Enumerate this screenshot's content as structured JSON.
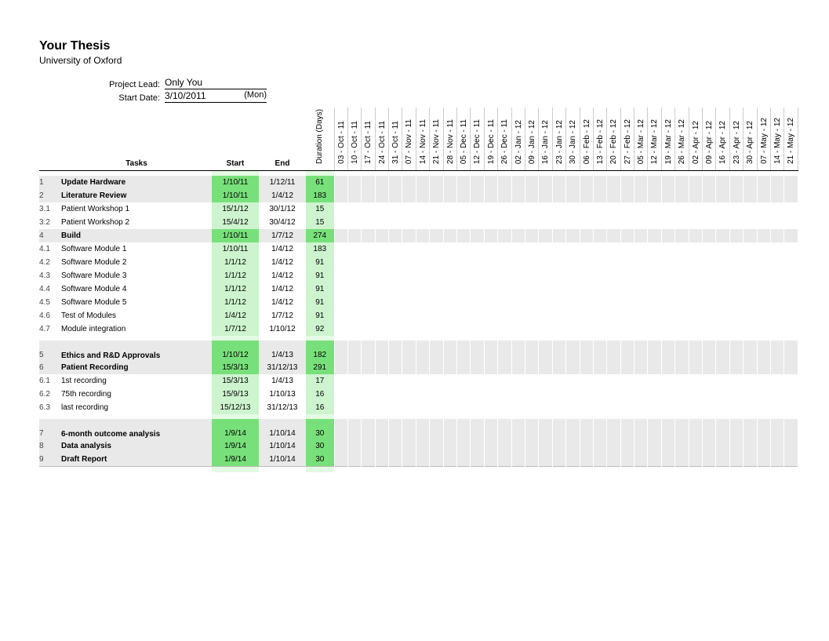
{
  "header": {
    "title": "Your Thesis",
    "subtitle": "University of Oxford",
    "lead_label": "Project Lead:",
    "lead_value": "Only You",
    "start_label": "Start Date:",
    "start_value": "3/10/2011",
    "start_day": "(Mon)"
  },
  "columns": {
    "tasks": "Tasks",
    "start": "Start",
    "end": "End",
    "duration": "Duration (Days)"
  },
  "dates": [
    "03 - Oct - 11",
    "10 - Oct - 11",
    "17 - Oct - 11",
    "24 - Oct - 11",
    "31 - Oct - 11",
    "07 - Nov - 11",
    "14 - Nov - 11",
    "21 - Nov - 11",
    "28 - Nov - 11",
    "05 - Dec - 11",
    "12 - Dec - 11",
    "19 - Dec - 11",
    "26 - Dec - 11",
    "02 - Jan - 12",
    "09 - Jan - 12",
    "16 - Jan - 12",
    "23 - Jan - 12",
    "30 - Jan - 12",
    "06 - Feb - 12",
    "13 - Feb - 12",
    "20 - Feb - 12",
    "27 - Feb - 12",
    "05 - Mar - 12",
    "12 - Mar - 12",
    "19 - Mar - 12",
    "26 - Mar - 12",
    "02 - Apr - 12",
    "09 - Apr - 12",
    "16 - Apr - 12",
    "23 - Apr - 12",
    "30 - Apr - 12",
    "07 - May - 12",
    "14 - May - 12",
    "21 - May - 12"
  ],
  "rows": [
    {
      "type": "spacer"
    },
    {
      "num": "1",
      "task": "Update Hardware",
      "start": "1/10/11",
      "end": "1/12/11",
      "dur": "61",
      "bold": true,
      "shade": true
    },
    {
      "num": "2",
      "task": "Literature Review",
      "start": "1/10/11",
      "end": "1/4/12",
      "dur": "183",
      "bold": true,
      "shade": true
    },
    {
      "num": "3.1",
      "task": "Patient Workshop 1",
      "start": "15/1/12",
      "end": "30/1/12",
      "dur": "15",
      "bold": false,
      "shade": false
    },
    {
      "num": "3.2",
      "task": "Patient Workshop 2",
      "start": "15/4/12",
      "end": "30/4/12",
      "dur": "15",
      "bold": false,
      "shade": false
    },
    {
      "num": "4",
      "task": "Build",
      "start": "1/10/11",
      "end": "1/7/12",
      "dur": "274",
      "bold": true,
      "shade": true
    },
    {
      "num": "4.1",
      "task": "Software Module 1",
      "start": "1/10/11",
      "end": "1/4/12",
      "dur": "183",
      "bold": false,
      "shade": false
    },
    {
      "num": "4.2",
      "task": "Software Module 2",
      "start": "1/1/12",
      "end": "1/4/12",
      "dur": "91",
      "bold": false,
      "shade": false
    },
    {
      "num": "4.3",
      "task": "Software Module 3",
      "start": "1/1/12",
      "end": "1/4/12",
      "dur": "91",
      "bold": false,
      "shade": false
    },
    {
      "num": "4.4",
      "task": "Software Module 4",
      "start": "1/1/12",
      "end": "1/4/12",
      "dur": "91",
      "bold": false,
      "shade": false
    },
    {
      "num": "4.5",
      "task": "Software Module 5",
      "start": "1/1/12",
      "end": "1/4/12",
      "dur": "91",
      "bold": false,
      "shade": false
    },
    {
      "num": "4.6",
      "task": "Test of Modules",
      "start": "1/4/12",
      "end": "1/7/12",
      "dur": "91",
      "bold": false,
      "shade": false
    },
    {
      "num": "4.7",
      "task": "Module integration",
      "start": "1/7/12",
      "end": "1/10/12",
      "dur": "92",
      "bold": false,
      "shade": false
    },
    {
      "type": "spacer"
    },
    {
      "num": "5",
      "task": "Ethics and R&D Approvals",
      "start": "1/10/12",
      "end": "1/4/13",
      "dur": "182",
      "bold": true,
      "shade": true,
      "tall": true
    },
    {
      "num": "6",
      "task": "Patient Recording",
      "start": "15/3/13",
      "end": "31/12/13",
      "dur": "291",
      "bold": true,
      "shade": true
    },
    {
      "num": "6.1",
      "task": "1st  recording",
      "start": "15/3/13",
      "end": "1/4/13",
      "dur": "17",
      "bold": false,
      "shade": false
    },
    {
      "num": "6.2",
      "task": "75th recording",
      "start": "15/9/13",
      "end": "1/10/13",
      "dur": "16",
      "bold": false,
      "shade": false
    },
    {
      "num": "6.3",
      "task": "last recording",
      "start": "15/12/13",
      "end": "31/12/13",
      "dur": "16",
      "bold": false,
      "shade": false
    },
    {
      "type": "spacer"
    },
    {
      "num": "7",
      "task": "6-month  outcome analysis",
      "start": "1/9/14",
      "end": "1/10/14",
      "dur": "30",
      "bold": true,
      "shade": true,
      "tall": true
    },
    {
      "num": "8",
      "task": "Data analysis",
      "start": "1/9/14",
      "end": "1/10/14",
      "dur": "30",
      "bold": true,
      "shade": true
    },
    {
      "num": "9",
      "task": "Draft Report",
      "start": "1/9/14",
      "end": "1/10/14",
      "dur": "30",
      "bold": true,
      "shade": true
    },
    {
      "type": "footer"
    }
  ]
}
